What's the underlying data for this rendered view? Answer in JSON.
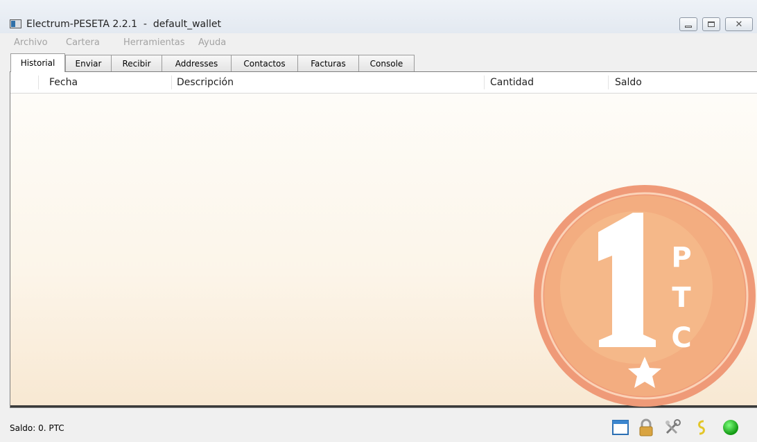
{
  "window": {
    "title": "Electrum-PESETA 2.2.1  -  default_wallet",
    "controls": [
      "minimize-icon",
      "maximize-icon",
      "close-icon"
    ]
  },
  "menu": {
    "items": [
      "Archivo",
      "Cartera",
      "Herramientas",
      "Ayuda"
    ]
  },
  "tabs": {
    "items": [
      "Historial",
      "Enviar",
      "Recibir",
      "Addresses",
      "Contactos",
      "Facturas",
      "Console"
    ],
    "active": "Historial"
  },
  "history_table": {
    "columns": [
      "",
      "Fecha",
      "Descripción",
      "Cantidad",
      "Saldo"
    ],
    "rows": []
  },
  "watermark": {
    "coin_value": "1",
    "letters": [
      "P",
      "T",
      "C"
    ],
    "colors": {
      "ring": "#ef9a78",
      "fill": "#f2ab7e",
      "inner": "#f6c08e"
    }
  },
  "status": {
    "balance_text": "Saldo: 0. PTC",
    "icons": [
      "window-icon",
      "lock-icon",
      "tools-icon",
      "seed-icon",
      "network-status-icon"
    ],
    "network_color": "#22bb22"
  }
}
